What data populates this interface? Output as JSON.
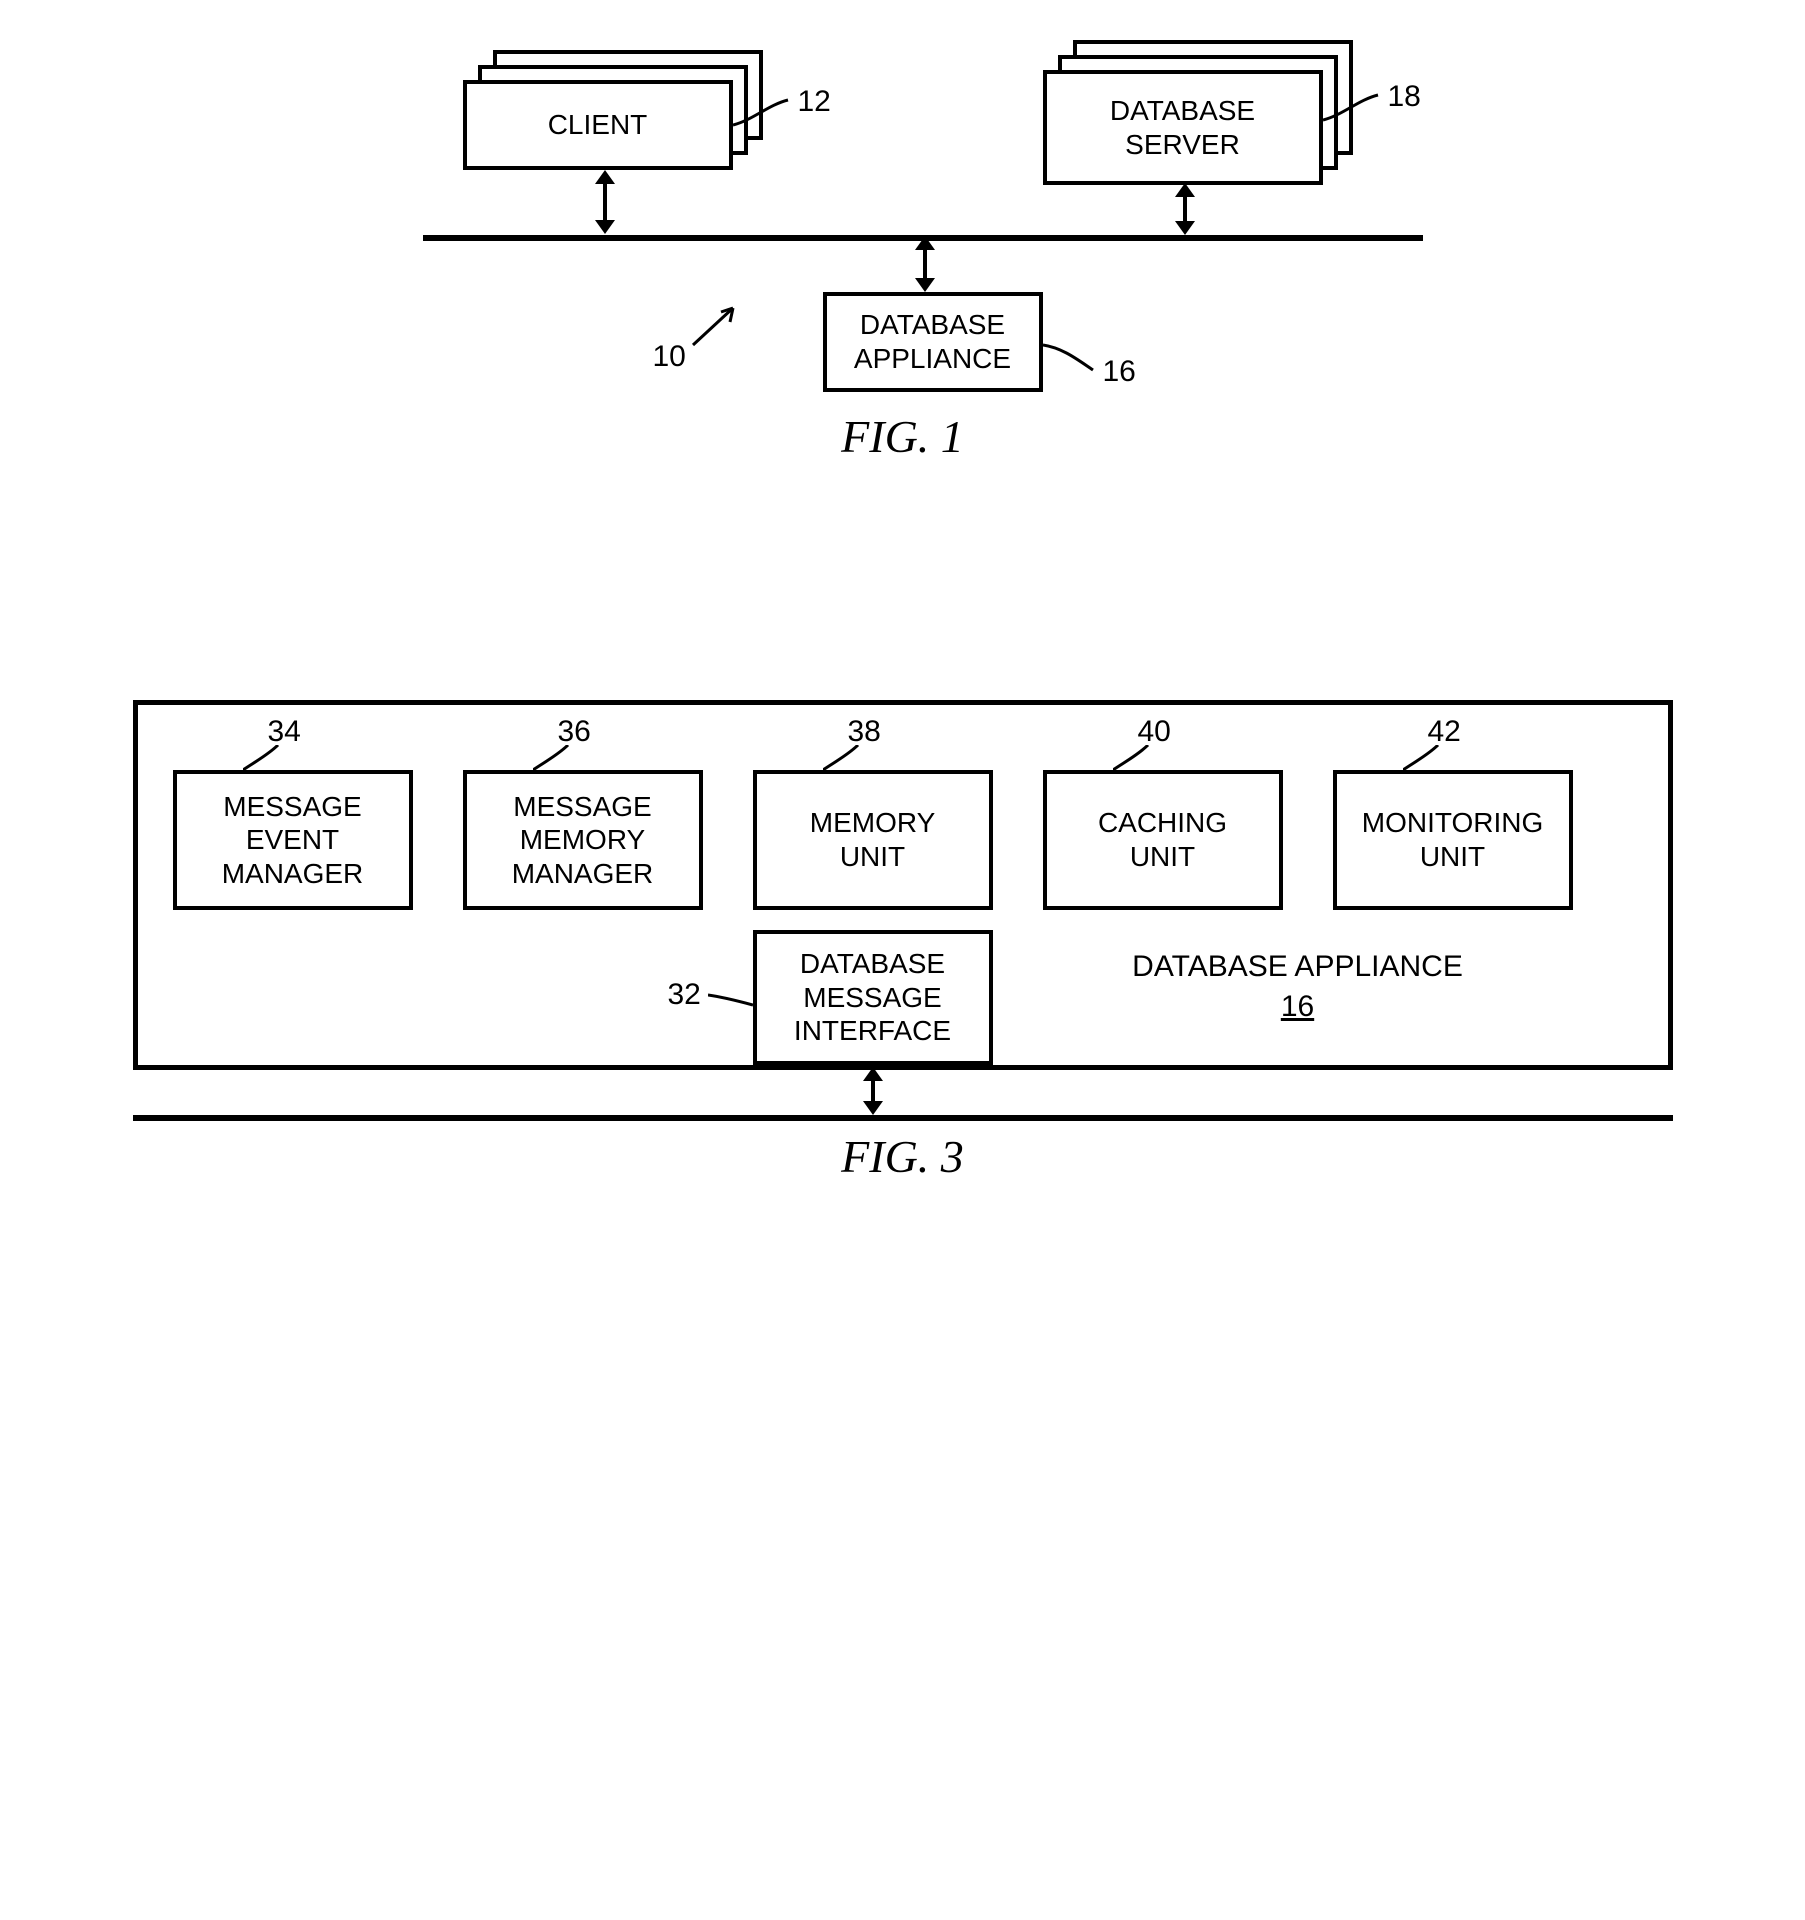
{
  "fig1": {
    "caption": "FIG. 1",
    "system_ref": "10",
    "client": {
      "label": "CLIENT",
      "ref": "12"
    },
    "server": {
      "label": "DATABASE\nSERVER",
      "ref": "18"
    },
    "appliance": {
      "label": "DATABASE\nAPPLIANCE",
      "ref": "16"
    }
  },
  "fig3": {
    "caption": "FIG. 3",
    "appliance_label": "DATABASE APPLIANCE",
    "appliance_ref": "16",
    "dmi": {
      "label": "DATABASE\nMESSAGE\nINTERFACE",
      "ref": "32"
    },
    "blocks": [
      {
        "label": "MESSAGE\nEVENT\nMANAGER",
        "ref": "34"
      },
      {
        "label": "MESSAGE\nMEMORY\nMANAGER",
        "ref": "36"
      },
      {
        "label": "MEMORY\nUNIT",
        "ref": "38"
      },
      {
        "label": "CACHING\nUNIT",
        "ref": "40"
      },
      {
        "label": "MONITORING\nUNIT",
        "ref": "42"
      }
    ]
  }
}
